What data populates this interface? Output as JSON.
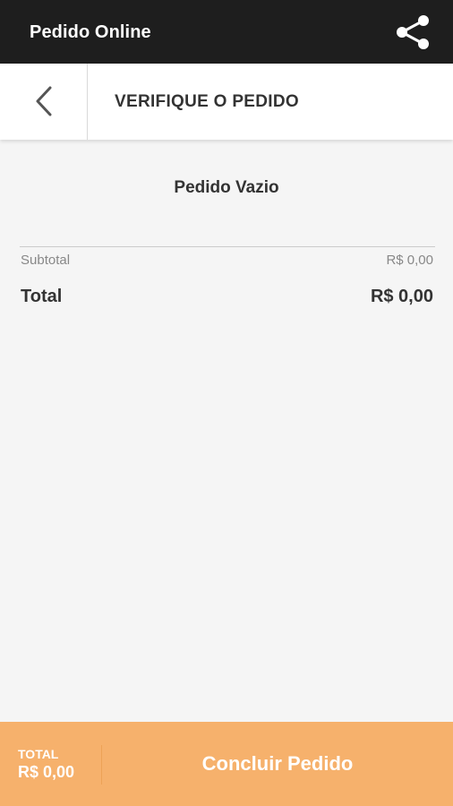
{
  "appbar": {
    "title": "Pedido Online",
    "share_icon": "share-icon"
  },
  "subheader": {
    "back_icon": "chevron-left-icon",
    "title": "VERIFIQUE O PEDIDO"
  },
  "order": {
    "empty_message": "Pedido Vazio",
    "subtotal_label": "Subtotal",
    "subtotal_value": "R$ 0,00",
    "total_label": "Total",
    "total_value": "R$ 0,00"
  },
  "footer": {
    "total_label": "TOTAL",
    "total_value": "R$ 0,00",
    "button_label": "Concluir Pedido"
  },
  "colors": {
    "appbar_bg": "#1e1e1e",
    "footer_bg": "#f6b16c",
    "background": "#f5f5f5"
  }
}
